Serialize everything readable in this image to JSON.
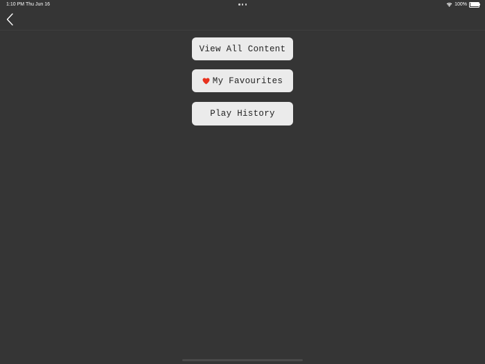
{
  "status_bar": {
    "time": "1:10 PM",
    "date": "Thu Jun 16",
    "battery": "100%",
    "icons": [
      "multitask-dots-icon",
      "wifi-icon",
      "battery-icon"
    ]
  },
  "nav": {
    "back_icon": "chevron-left-icon"
  },
  "menu": {
    "view_all_label": "View All Content",
    "favourites_label": "My Favourites",
    "favourites_icon": "heart-icon",
    "history_label": "Play History"
  },
  "colors": {
    "background": "#353535",
    "button": "#ebebeb",
    "button_text": "#222222",
    "heart": "#e8321e"
  }
}
